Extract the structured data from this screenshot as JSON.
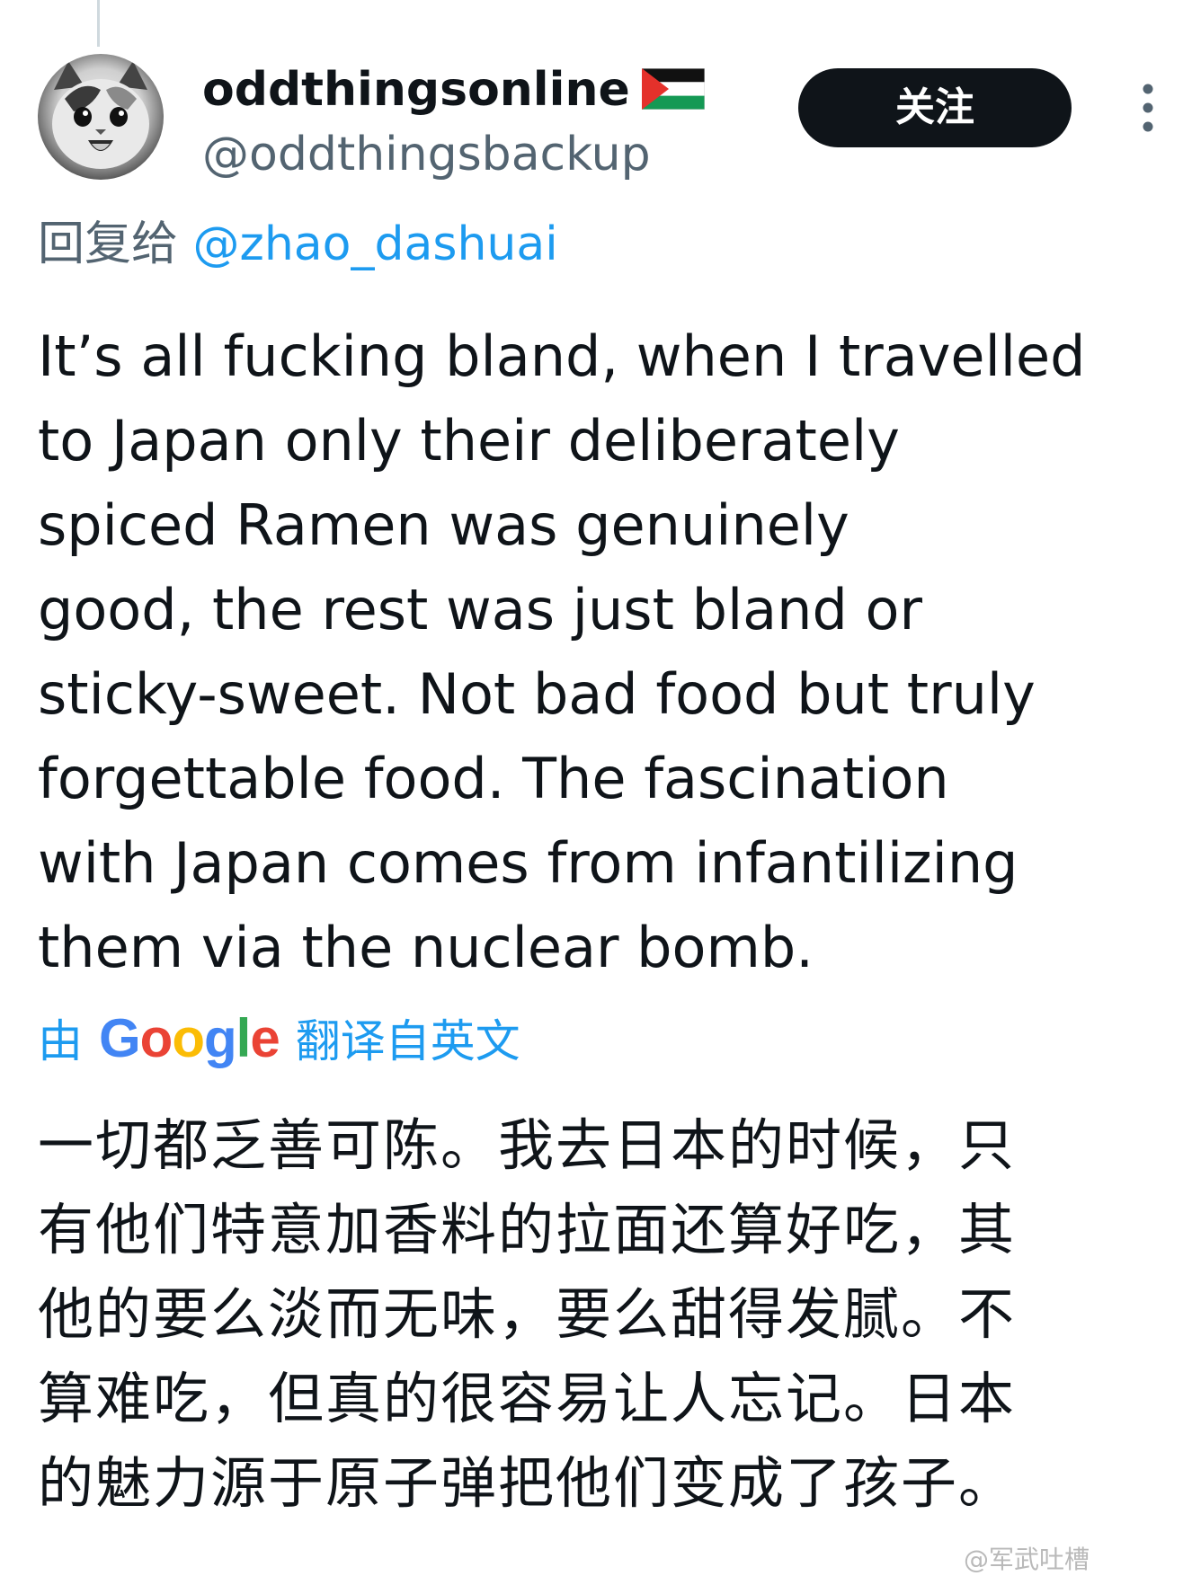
{
  "author": {
    "display_name": "oddthingsonline",
    "handle": "@oddthingsbackup",
    "flag_icon": "palestine-flag-icon",
    "avatar": "cat-avatar"
  },
  "actions": {
    "follow_label": "关注",
    "more_icon": "more-vertical-icon"
  },
  "reply": {
    "prefix": "回复给",
    "mention": "@zhao_dashuai"
  },
  "tweet": {
    "lines": [
      "It’s all fucking bland, when I travelled",
      "to Japan only their deliberately",
      "spiced Ramen was genuinely",
      "good, the rest was just bland or",
      "sticky-sweet. Not bad food but truly",
      "forgettable food. The fascination",
      "with Japan comes from infantilizing",
      "them via the nuclear bomb."
    ]
  },
  "translation": {
    "prefix": "由",
    "provider": "Google",
    "suffix": "翻译自英文",
    "lines": [
      "一切都乏善可陈。我去日本的时候，只",
      "有他们特意加香料的拉面还算好吃，其",
      "他的要么淡而无味，要么甜得发腻。不",
      "算难吃，但真的很容易让人忘记。日本",
      "的魅力源于原子弹把他们变成了孩子。"
    ]
  },
  "watermark": "@军武吐槽",
  "colors": {
    "text": "#0f1419",
    "secondary": "#536471",
    "link": "#1d9bf0",
    "button_bg": "#0f1419"
  }
}
